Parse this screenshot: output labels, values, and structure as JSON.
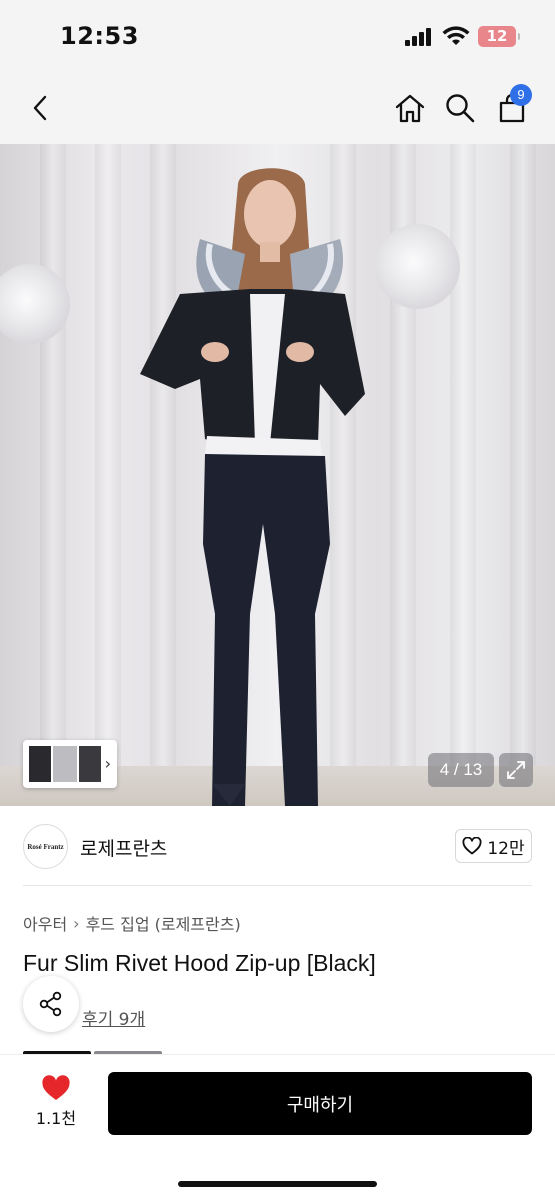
{
  "status_bar": {
    "time": "12:53",
    "battery": "12"
  },
  "nav": {
    "cart_count": "9"
  },
  "gallery": {
    "page_indicator": "4 / 13"
  },
  "brand": {
    "logo_text": "Rosé Frantz",
    "name": "로제프란츠",
    "likes": "12만"
  },
  "breadcrumb": {
    "category": "아우터",
    "subcategory": "후드 집업 (로제프란츠)"
  },
  "product": {
    "title": "Fur Slim Rivet Hood Zip-up [Black]",
    "review_link": "후기 9개"
  },
  "bottom_bar": {
    "wish_count": "1.1천",
    "buy_label": "구매하기"
  },
  "colors": {
    "accent_badge": "#2f6fe8",
    "heart": "#e5262b",
    "buy_button": "#000000",
    "battery_low": "#e8868b"
  }
}
